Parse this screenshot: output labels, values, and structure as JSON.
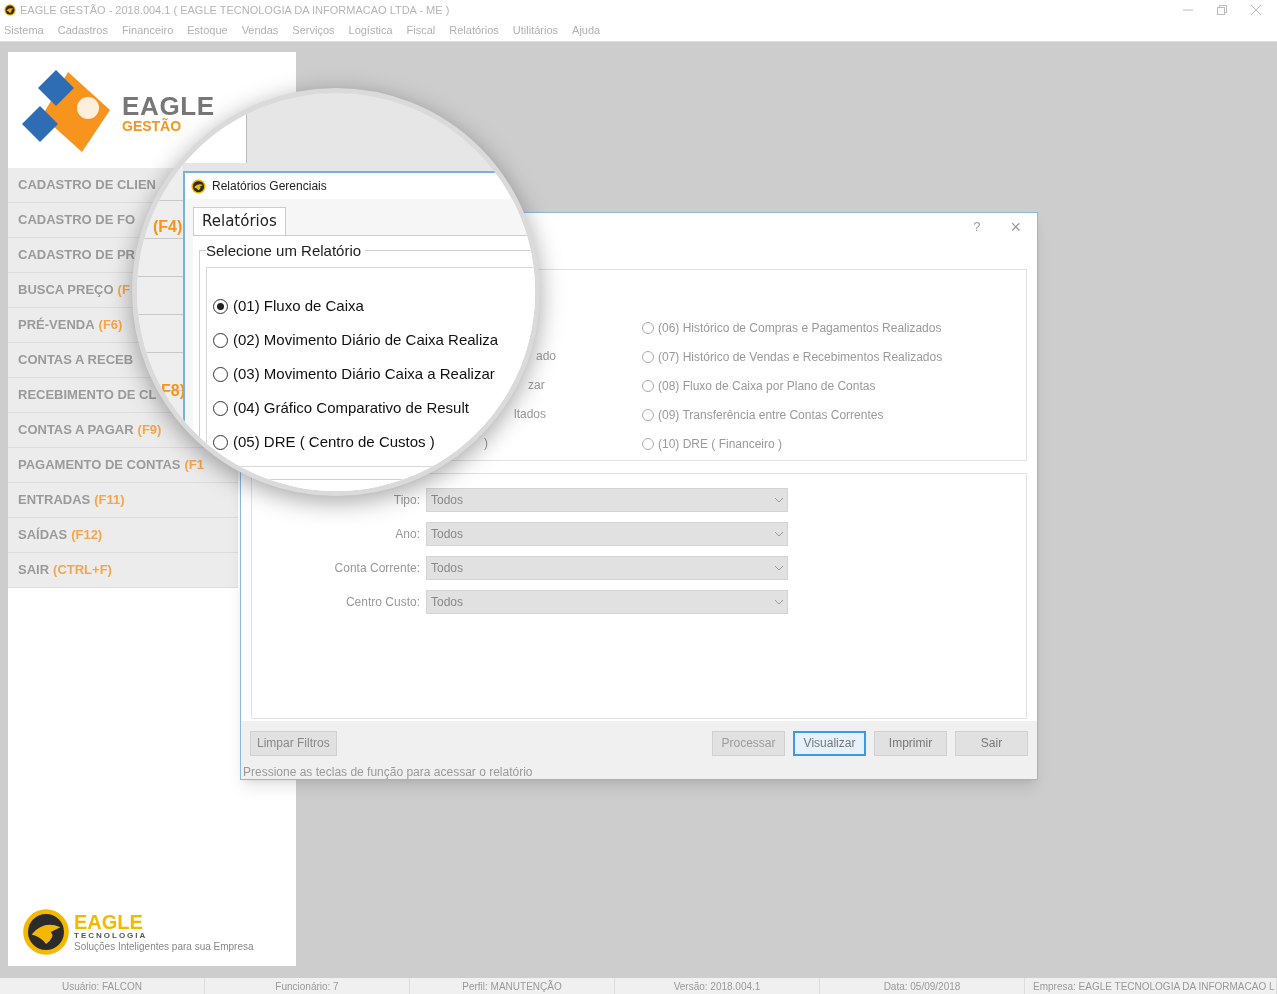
{
  "window": {
    "title": "EAGLE GESTÃO - 2018.004.1 ( EAGLE TECNOLOGIA DA INFORMACAO LTDA - ME )"
  },
  "menu": [
    "Sistema",
    "Cadastros",
    "Financeiro",
    "Estoque",
    "Vendas",
    "Serviços",
    "Logística",
    "Fiscal",
    "Relatórios",
    "Utilitários",
    "Ajuda"
  ],
  "sidebar": {
    "logo": {
      "name": "EAGLE",
      "sub": "GESTÃO"
    },
    "items": [
      {
        "label": "CADASTRO DE CLIEN"
      },
      {
        "label": "CADASTRO DE FO"
      },
      {
        "label": "CADASTRO DE PR"
      },
      {
        "label": "BUSCA PREÇO",
        "key": "(F"
      },
      {
        "label": "PRÉ-VENDA",
        "key": "(F6)"
      },
      {
        "label": "CONTAS A RECEB"
      },
      {
        "label": "RECEBIMENTO DE CL"
      },
      {
        "label": "CONTAS A PAGAR",
        "key": "(F9)"
      },
      {
        "label": "PAGAMENTO DE CONTAS",
        "key": "(F1"
      },
      {
        "label": "ENTRADAS",
        "key": "(F11)"
      },
      {
        "label": "SAÍDAS",
        "key": "(F12)"
      },
      {
        "label": "SAIR",
        "key": "(CTRL+F)"
      }
    ],
    "footer_logo": {
      "name": "EAGLE",
      "sub": "TECNOLOGIA",
      "tagline": "Soluções Inteligentes para sua Empresa"
    }
  },
  "dialog": {
    "help": "?",
    "close": "×",
    "left_tails": [
      "ado",
      "zar",
      "ltados",
      ")"
    ],
    "reports": [
      {
        "label": "(06) Histórico de Compras e Pagamentos Realizados",
        "selected": false
      },
      {
        "label": "(07) Histórico de Vendas e Recebimentos Realizados",
        "selected": false
      },
      {
        "label": "(08) Fluxo de Caixa por Plano de Contas",
        "selected": false
      },
      {
        "label": "(09) Transferência entre Contas Correntes",
        "selected": false
      },
      {
        "label": "(10) DRE ( Financeiro )",
        "selected": false
      }
    ],
    "filters": [
      {
        "label": "Tipo:",
        "value": "Todos"
      },
      {
        "label": "Ano:",
        "value": "Todos"
      },
      {
        "label": "Conta Corrente:",
        "value": "Todos"
      },
      {
        "label": "Centro Custo:",
        "value": "Todos"
      }
    ],
    "clear_button": "Limpar Filtros",
    "buttons": [
      {
        "label": "Processar",
        "disabled": true,
        "focused": false
      },
      {
        "label": "Visualizar",
        "disabled": false,
        "focused": true
      },
      {
        "label": "Imprimir",
        "disabled": false,
        "focused": false
      },
      {
        "label": "Sair",
        "disabled": false,
        "focused": false
      }
    ],
    "hint": "Pressione as teclas de função para acessar o relatório"
  },
  "lens": {
    "sidebar_keys": [
      "(F4)",
      "F8)"
    ],
    "dialog_title": "Relatórios Gerenciais",
    "tab": {
      "label": "Relatórios",
      "selected": true
    },
    "group_title": "Selecione um Relatório",
    "reports": [
      {
        "label": "(01) Fluxo de Caixa",
        "selected": true
      },
      {
        "label": "(02) Movimento Diário de Caixa Realiza",
        "selected": false
      },
      {
        "label": "(03) Movimento Diário Caixa a Realizar",
        "selected": false
      },
      {
        "label": "(04) Gráfico Comparativo de Result",
        "selected": false
      },
      {
        "label": "(05) DRE ( Centro de Custos )",
        "selected": false
      }
    ]
  },
  "status_bar": [
    "Usuário: FALCON",
    "Funcionário: 7",
    "Perfil: MANUTENÇÃO",
    "Versão: 2018.004.1",
    "Data: 05/09/2018",
    "Empresa: EAGLE TECNOLOGIA DA INFORMACAO L"
  ]
}
